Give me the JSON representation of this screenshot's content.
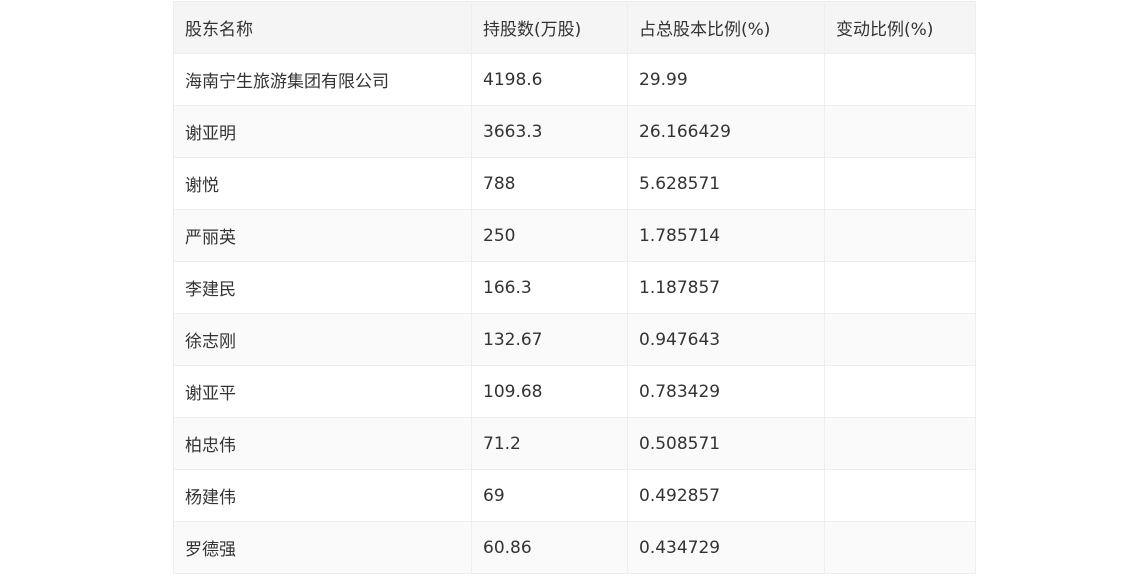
{
  "table": {
    "headers": [
      "股东名称",
      "持股数(万股)",
      "占总股本比例(%)",
      "变动比例(%)"
    ],
    "rows": [
      [
        "海南宁生旅游集团有限公司",
        "4198.6",
        "29.99",
        ""
      ],
      [
        "谢亚明",
        "3663.3",
        "26.166429",
        ""
      ],
      [
        "谢悦",
        "788",
        "5.628571",
        ""
      ],
      [
        "严丽英",
        "250",
        "1.785714",
        ""
      ],
      [
        "李建民",
        "166.3",
        "1.187857",
        ""
      ],
      [
        "徐志刚",
        "132.67",
        "0.947643",
        ""
      ],
      [
        "谢亚平",
        "109.68",
        "0.783429",
        ""
      ],
      [
        "柏忠伟",
        "71.2",
        "0.508571",
        ""
      ],
      [
        "杨建伟",
        "69",
        "0.492857",
        ""
      ],
      [
        "罗德强",
        "60.86",
        "0.434729",
        ""
      ]
    ]
  }
}
